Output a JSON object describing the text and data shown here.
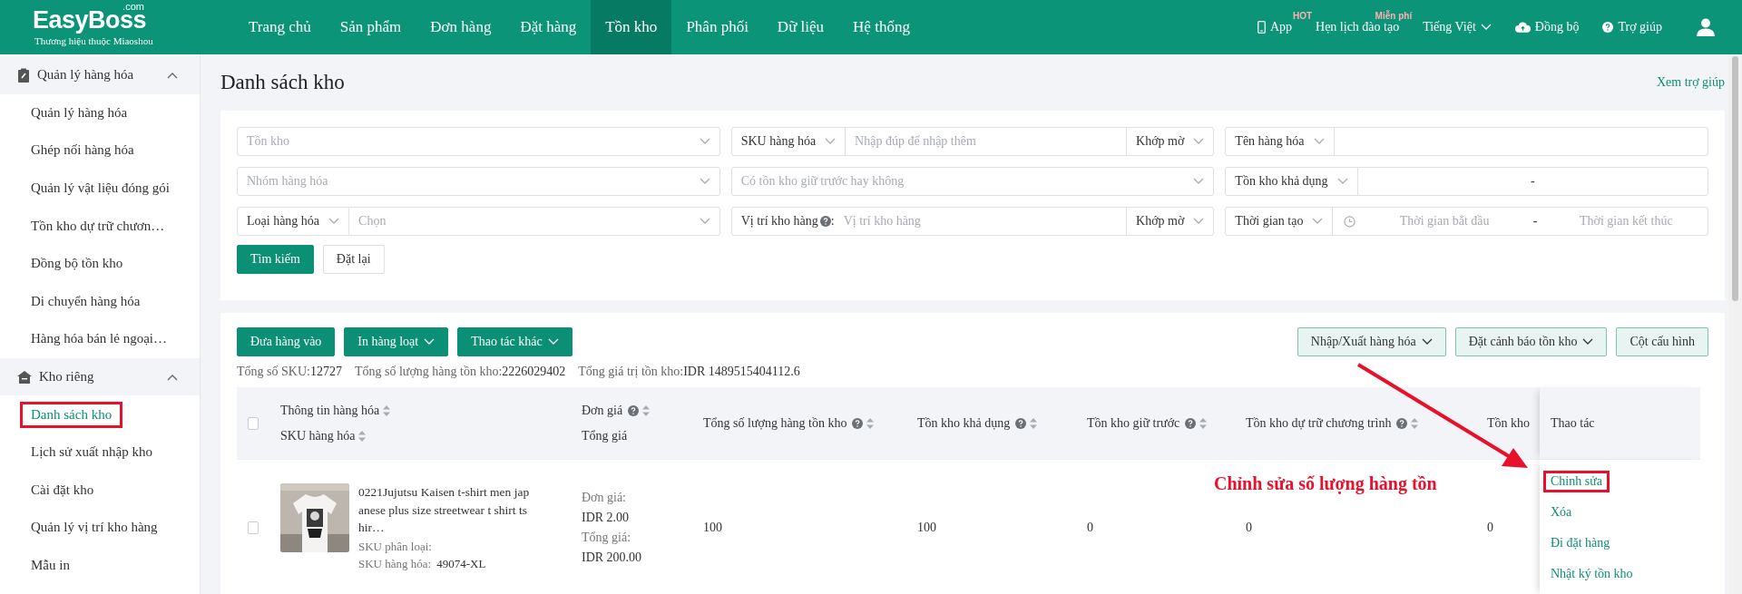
{
  "topbar": {
    "logo": {
      "name": "EasyBoss",
      "suffix": ".com",
      "tagline": "Thương hiệu thuộc Miaoshou"
    },
    "nav": [
      {
        "label": "Trang chủ",
        "selected": false
      },
      {
        "label": "Sản phẩm",
        "selected": false
      },
      {
        "label": "Đơn hàng",
        "selected": false
      },
      {
        "label": "Đặt hàng",
        "selected": false
      },
      {
        "label": "Tồn kho",
        "selected": true
      },
      {
        "label": "Phân phối",
        "selected": false
      },
      {
        "label": "Dữ liệu",
        "selected": false
      },
      {
        "label": "Hệ thống",
        "selected": false
      }
    ],
    "app": {
      "label": "App",
      "badge": "HOT"
    },
    "training": {
      "label": "Hẹn lịch đào tạo",
      "badge": "Miễn phí"
    },
    "language": "Tiếng Việt",
    "sync": "Đồng bộ",
    "help": "Trợ giúp"
  },
  "sidebar": {
    "groups": [
      {
        "label": "Quản lý hàng hóa",
        "expanded": true,
        "items": [
          {
            "label": "Quản lý hàng hóa",
            "selected": false,
            "annotated": false
          },
          {
            "label": "Ghép nối hàng hóa",
            "selected": false,
            "annotated": false
          },
          {
            "label": "Quản lý vật liệu đóng gói",
            "selected": false,
            "annotated": false
          },
          {
            "label": "Tồn kho dự trữ chươn…",
            "selected": false,
            "annotated": false
          },
          {
            "label": "Đồng bộ tồn kho",
            "selected": false,
            "annotated": false
          },
          {
            "label": "Di chuyển hàng hóa",
            "selected": false,
            "annotated": false
          },
          {
            "label": "Hàng hóa bán lẻ ngoại…",
            "selected": false,
            "annotated": false
          }
        ]
      },
      {
        "label": "Kho riêng",
        "expanded": true,
        "items": [
          {
            "label": "Danh sách kho",
            "selected": true,
            "annotated": true
          },
          {
            "label": "Lịch sử xuất nhập kho",
            "selected": false,
            "annotated": false
          },
          {
            "label": "Cài đặt kho",
            "selected": false,
            "annotated": false
          },
          {
            "label": "Quản lý vị trí kho hàng",
            "selected": false,
            "annotated": false
          },
          {
            "label": "Mẫu in",
            "selected": false,
            "annotated": false
          }
        ]
      }
    ]
  },
  "page": {
    "title": "Danh sách kho",
    "help_link": "Xem trợ giúp"
  },
  "filters": [
    [
      {
        "kind": "select",
        "placeholder": "Tồn kho"
      },
      {
        "kind": "keyed",
        "key": "SKU hàng hóa",
        "placeholder": "Nhập đúp để nhập thêm",
        "match": "Khớp mờ"
      },
      {
        "kind": "keyed",
        "key": "Tên hàng hóa"
      }
    ],
    [
      {
        "kind": "select",
        "placeholder": "Nhóm hàng hóa"
      },
      {
        "kind": "select",
        "placeholder": "Có tồn kho giữ trước hay không"
      },
      {
        "kind": "range",
        "key": "Tồn kho khả dụng",
        "separator": "-"
      }
    ],
    [
      {
        "kind": "keyed-select",
        "key": "Loại hàng hóa",
        "placeholder": "Chọn"
      },
      {
        "kind": "labeled",
        "label": "Vị trí kho hàng",
        "label_suffix": ":",
        "placeholder": "Vị trí kho hàng",
        "match": "Khớp mờ"
      },
      {
        "kind": "date-range",
        "key": "Thời gian tạo",
        "start": "Thời gian bắt đầu",
        "separator": "-",
        "end": "Thời gian kết thúc"
      }
    ]
  ],
  "filter_buttons": [
    {
      "label": "Tìm kiếm",
      "kind": "primary"
    },
    {
      "label": "Đặt lại",
      "kind": "plain"
    }
  ],
  "toolbar": {
    "left": [
      {
        "label": "Đưa hàng vào",
        "dropdown": false
      },
      {
        "label": "In hàng loạt",
        "dropdown": true
      },
      {
        "label": "Thao tác khác",
        "dropdown": true
      }
    ],
    "right": [
      {
        "label": "Nhập/Xuất hàng hóa",
        "dropdown": true
      },
      {
        "label": "Đặt cảnh báo tồn kho",
        "dropdown": true
      },
      {
        "label": "Cột cấu hình",
        "dropdown": false
      }
    ]
  },
  "summary": [
    {
      "label": "Tổng số SKU:",
      "value": "12727"
    },
    {
      "label": "Tổng số lượng hàng tồn kho:",
      "value": "2226029402"
    },
    {
      "label": "Tổng giá trị tồn kho:",
      "value": "IDR 1489515404112.6"
    }
  ],
  "table": {
    "header_checked": false,
    "columns": [
      {
        "label": "Thông tin hàng hóa",
        "help": false,
        "sortable": true,
        "sublabel": "SKU hàng hóa",
        "sub_sortable": true
      },
      {
        "label": "Đơn giá",
        "help": true,
        "sortable": true,
        "sublabel": "Tổng giá",
        "sub_sortable": false
      },
      {
        "label": "Tổng số lượng hàng tồn kho",
        "help": true,
        "sortable": true
      },
      {
        "label": "Tồn kho khả dụng",
        "help": true,
        "sortable": true
      },
      {
        "label": "Tồn kho giữ trước",
        "help": true,
        "sortable": true
      },
      {
        "label": "Tồn kho dự trữ chương trình",
        "help": true,
        "sortable": true
      },
      {
        "label": "Tồn kho",
        "help": false,
        "sortable": false
      },
      {
        "label": "Thao tác",
        "help": false,
        "sortable": false
      }
    ],
    "rows": [
      {
        "checked": false,
        "product": {
          "kind": "picture",
          "name": "0221Jujutsu Kaisen t-shirt men japanese plus size streetwear t shirt tshir…",
          "variant_label": "SKU phân loại:",
          "sku_label": "SKU hàng hóa:",
          "sku": "49074-XL"
        },
        "price": {
          "unit_label": "Đơn giá:",
          "unit": "IDR 2.00",
          "total_label": "Tổng giá:",
          "total": "IDR 200.00"
        },
        "values": [
          "100",
          "100",
          "0",
          "0",
          "0"
        ],
        "actions": [
          {
            "label": "Chỉnh sửa",
            "annotated": true
          },
          {
            "label": "Xóa",
            "annotated": false
          },
          {
            "label": "Đi đặt hàng",
            "annotated": false
          },
          {
            "label": "Nhật ký tồn kho",
            "annotated": false
          }
        ]
      }
    ]
  },
  "annotation": {
    "text": "Chỉnh sửa số lượng hàng tồn"
  }
}
